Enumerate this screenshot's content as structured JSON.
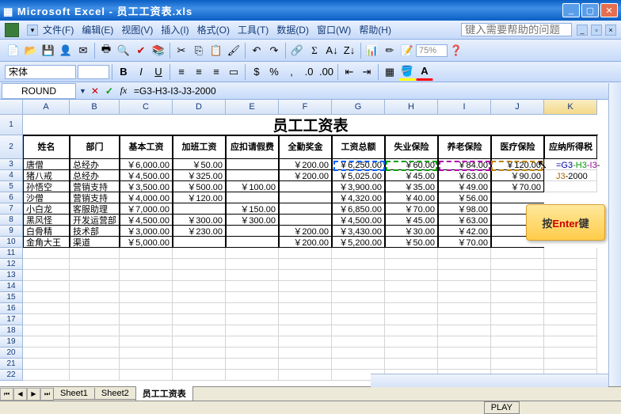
{
  "window": {
    "app": "Microsoft Excel",
    "dash": " - ",
    "filename": "员工工资表.xls"
  },
  "menu": {
    "items": [
      "文件(F)",
      "编辑(E)",
      "视图(V)",
      "插入(I)",
      "格式(O)",
      "工具(T)",
      "数据(D)",
      "窗口(W)",
      "帮助(H)"
    ],
    "help_placeholder": "键入需要帮助的问题"
  },
  "toolbar": {
    "zoom": "75%"
  },
  "format": {
    "font": "宋体",
    "size": ""
  },
  "formula": {
    "name": "ROUND",
    "value": "=G3-H3-I3-J3-2000"
  },
  "columns": [
    "A",
    "B",
    "C",
    "D",
    "E",
    "F",
    "G",
    "H",
    "I",
    "J",
    "K"
  ],
  "sheet_title": "员工工资表",
  "headers": [
    "姓名",
    "部门",
    "基本工资",
    "加班工资",
    "应扣请假费",
    "全勤奖金",
    "工资总额",
    "失业保险",
    "养老保险",
    "医疗保险",
    "应纳所得税"
  ],
  "chart_data": {
    "type": "table",
    "columns": [
      "姓名",
      "部门",
      "基本工资",
      "加班工资",
      "应扣请假费",
      "全勤奖金",
      "工资总额",
      "失业保险",
      "养老保险",
      "医疗保险"
    ],
    "rows": [
      {
        "name": "唐僧",
        "dept": "总经办",
        "base": "￥6,000.00",
        "ot": "￥50.00",
        "deduct": "",
        "bonus": "￥200.00",
        "total": "￥6,250.00",
        "ins1": "￥60.00",
        "ins2": "￥84.00",
        "ins3": "￥120.00"
      },
      {
        "name": "猪八戒",
        "dept": "总经办",
        "base": "￥4,500.00",
        "ot": "￥325.00",
        "deduct": "",
        "bonus": "￥200.00",
        "total": "￥5,025.00",
        "ins1": "￥45.00",
        "ins2": "￥63.00",
        "ins3": "￥90.00"
      },
      {
        "name": "孙悟空",
        "dept": "营销支持",
        "base": "￥3,500.00",
        "ot": "￥500.00",
        "deduct": "￥100.00",
        "bonus": "",
        "total": "￥3,900.00",
        "ins1": "￥35.00",
        "ins2": "￥49.00",
        "ins3": "￥70.00"
      },
      {
        "name": "沙僧",
        "dept": "营销支持",
        "base": "￥4,000.00",
        "ot": "￥120.00",
        "deduct": "",
        "bonus": "",
        "total": "￥4,320.00",
        "ins1": "￥40.00",
        "ins2": "￥56.00",
        "ins3": "",
        "_cut": true
      },
      {
        "name": "小白龙",
        "dept": "客服助理",
        "base": "￥7,000.00",
        "ot": "",
        "deduct": "￥150.00",
        "bonus": "",
        "total": "￥6,850.00",
        "ins1": "￥70.00",
        "ins2": "￥98.00",
        "ins3": "",
        "_cut": true
      },
      {
        "name": "黑风怪",
        "dept": "开发运营部",
        "base": "￥4,500.00",
        "ot": "￥300.00",
        "deduct": "￥300.00",
        "bonus": "",
        "total": "￥4,500.00",
        "ins1": "￥45.00",
        "ins2": "￥63.00",
        "ins3": "",
        "_cut": true
      },
      {
        "name": "白骨精",
        "dept": "技术部",
        "base": "￥3,000.00",
        "ot": "￥230.00",
        "deduct": "",
        "bonus": "￥200.00",
        "total": "￥3,430.00",
        "ins1": "￥30.00",
        "ins2": "￥42.00",
        "ins3": "",
        "_cut": true
      },
      {
        "name": "金角大王",
        "dept": "渠道",
        "base": "￥5,000.00",
        "ot": "",
        "deduct": "",
        "bonus": "￥200.00",
        "total": "￥5,200.00",
        "ins1": "￥50.00",
        "ins2": "￥70.00",
        "ins3": "",
        "_cut": true
      }
    ]
  },
  "callout": {
    "prefix": "按",
    "key": "Enter",
    "suffix": "键"
  },
  "edit_formula": {
    "g": "=G3",
    "h": "-H3",
    "i": "-I3",
    "j": "-",
    "j2": "J3",
    "tail": "-2000"
  },
  "tabs": [
    "Sheet1",
    "Sheet2",
    "员工工资表"
  ],
  "status": {
    "play": "PLAY"
  }
}
